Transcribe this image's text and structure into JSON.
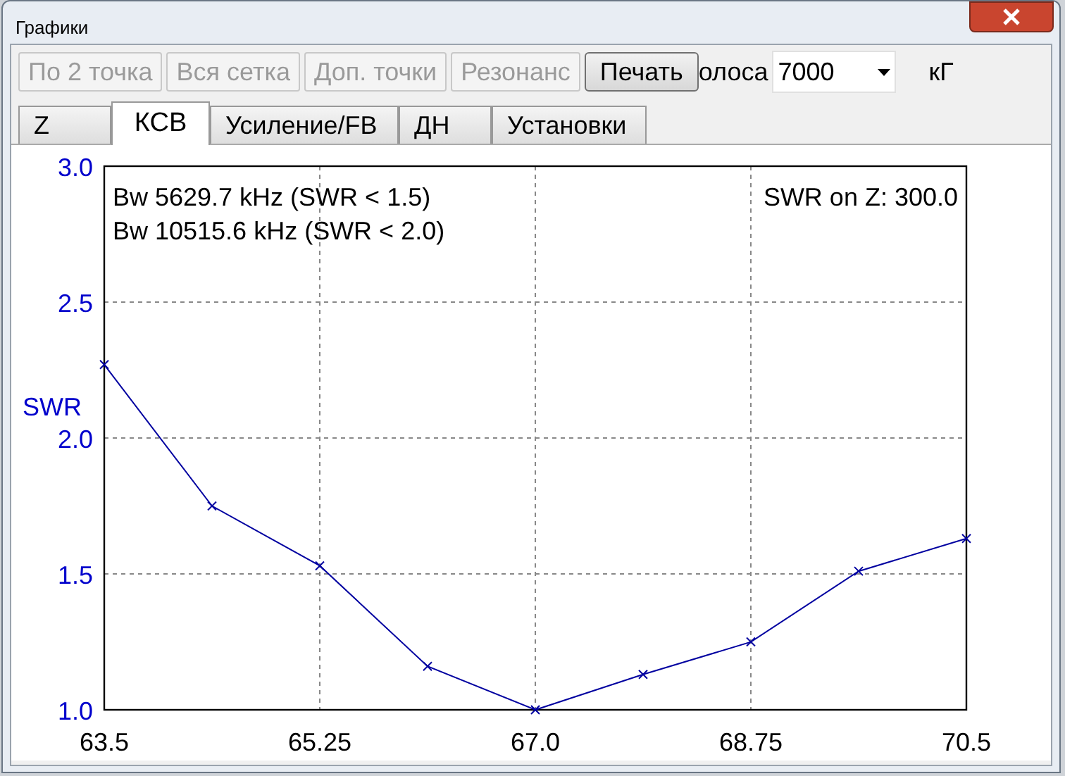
{
  "window": {
    "title": "Графики"
  },
  "toolbar": {
    "buttons": [
      {
        "label": "По 2 точка",
        "disabled": true
      },
      {
        "label": "Вся сетка",
        "disabled": true
      },
      {
        "label": "Доп. точки",
        "disabled": true
      },
      {
        "label": "Резонанс",
        "disabled": true
      },
      {
        "label": "Печать",
        "disabled": false
      }
    ],
    "band_label": "олоса",
    "band_value": "7000",
    "unit": "кГ"
  },
  "tabs": [
    {
      "label": "Z",
      "selected": false
    },
    {
      "label": "КСВ",
      "selected": true
    },
    {
      "label": "Усиление/FB",
      "selected": false
    },
    {
      "label": "ДН",
      "selected": false
    },
    {
      "label": "Установки",
      "selected": false
    }
  ],
  "chart_data": {
    "type": "line",
    "grid": true,
    "x": [
      63.5,
      64.375,
      65.25,
      66.125,
      67.0,
      67.875,
      68.75,
      69.625,
      70.5
    ],
    "series": [
      {
        "name": "SWR",
        "color": "#0000a0",
        "marker": "x",
        "values": [
          2.27,
          1.75,
          1.53,
          1.16,
          1.0,
          1.13,
          1.25,
          1.51,
          1.63
        ]
      }
    ],
    "xlim": [
      63.5,
      70.5
    ],
    "ylim": [
      1.0,
      3.0
    ],
    "xticks": [
      63.5,
      {
        "value": 65.25,
        "label": "65.25"
      },
      {
        "value": 67.0,
        "label": "67.0"
      },
      {
        "value": 68.75,
        "label": "68.75"
      },
      70.5
    ],
    "yticks": [
      {
        "value": 1.0,
        "label": "1.0"
      },
      {
        "value": 1.5,
        "label": "1.5"
      },
      {
        "value": 2.0,
        "label": "2.0"
      },
      {
        "value": 2.5,
        "label": "2.5"
      },
      {
        "value": 3.0,
        "label": "3.0"
      }
    ],
    "annotations": [
      "Bw 5629.7 kHz (SWR < 1.5)",
      "Bw 10515.6 kHz (SWR < 2.0)",
      "SWR on Z: 300.0"
    ]
  }
}
